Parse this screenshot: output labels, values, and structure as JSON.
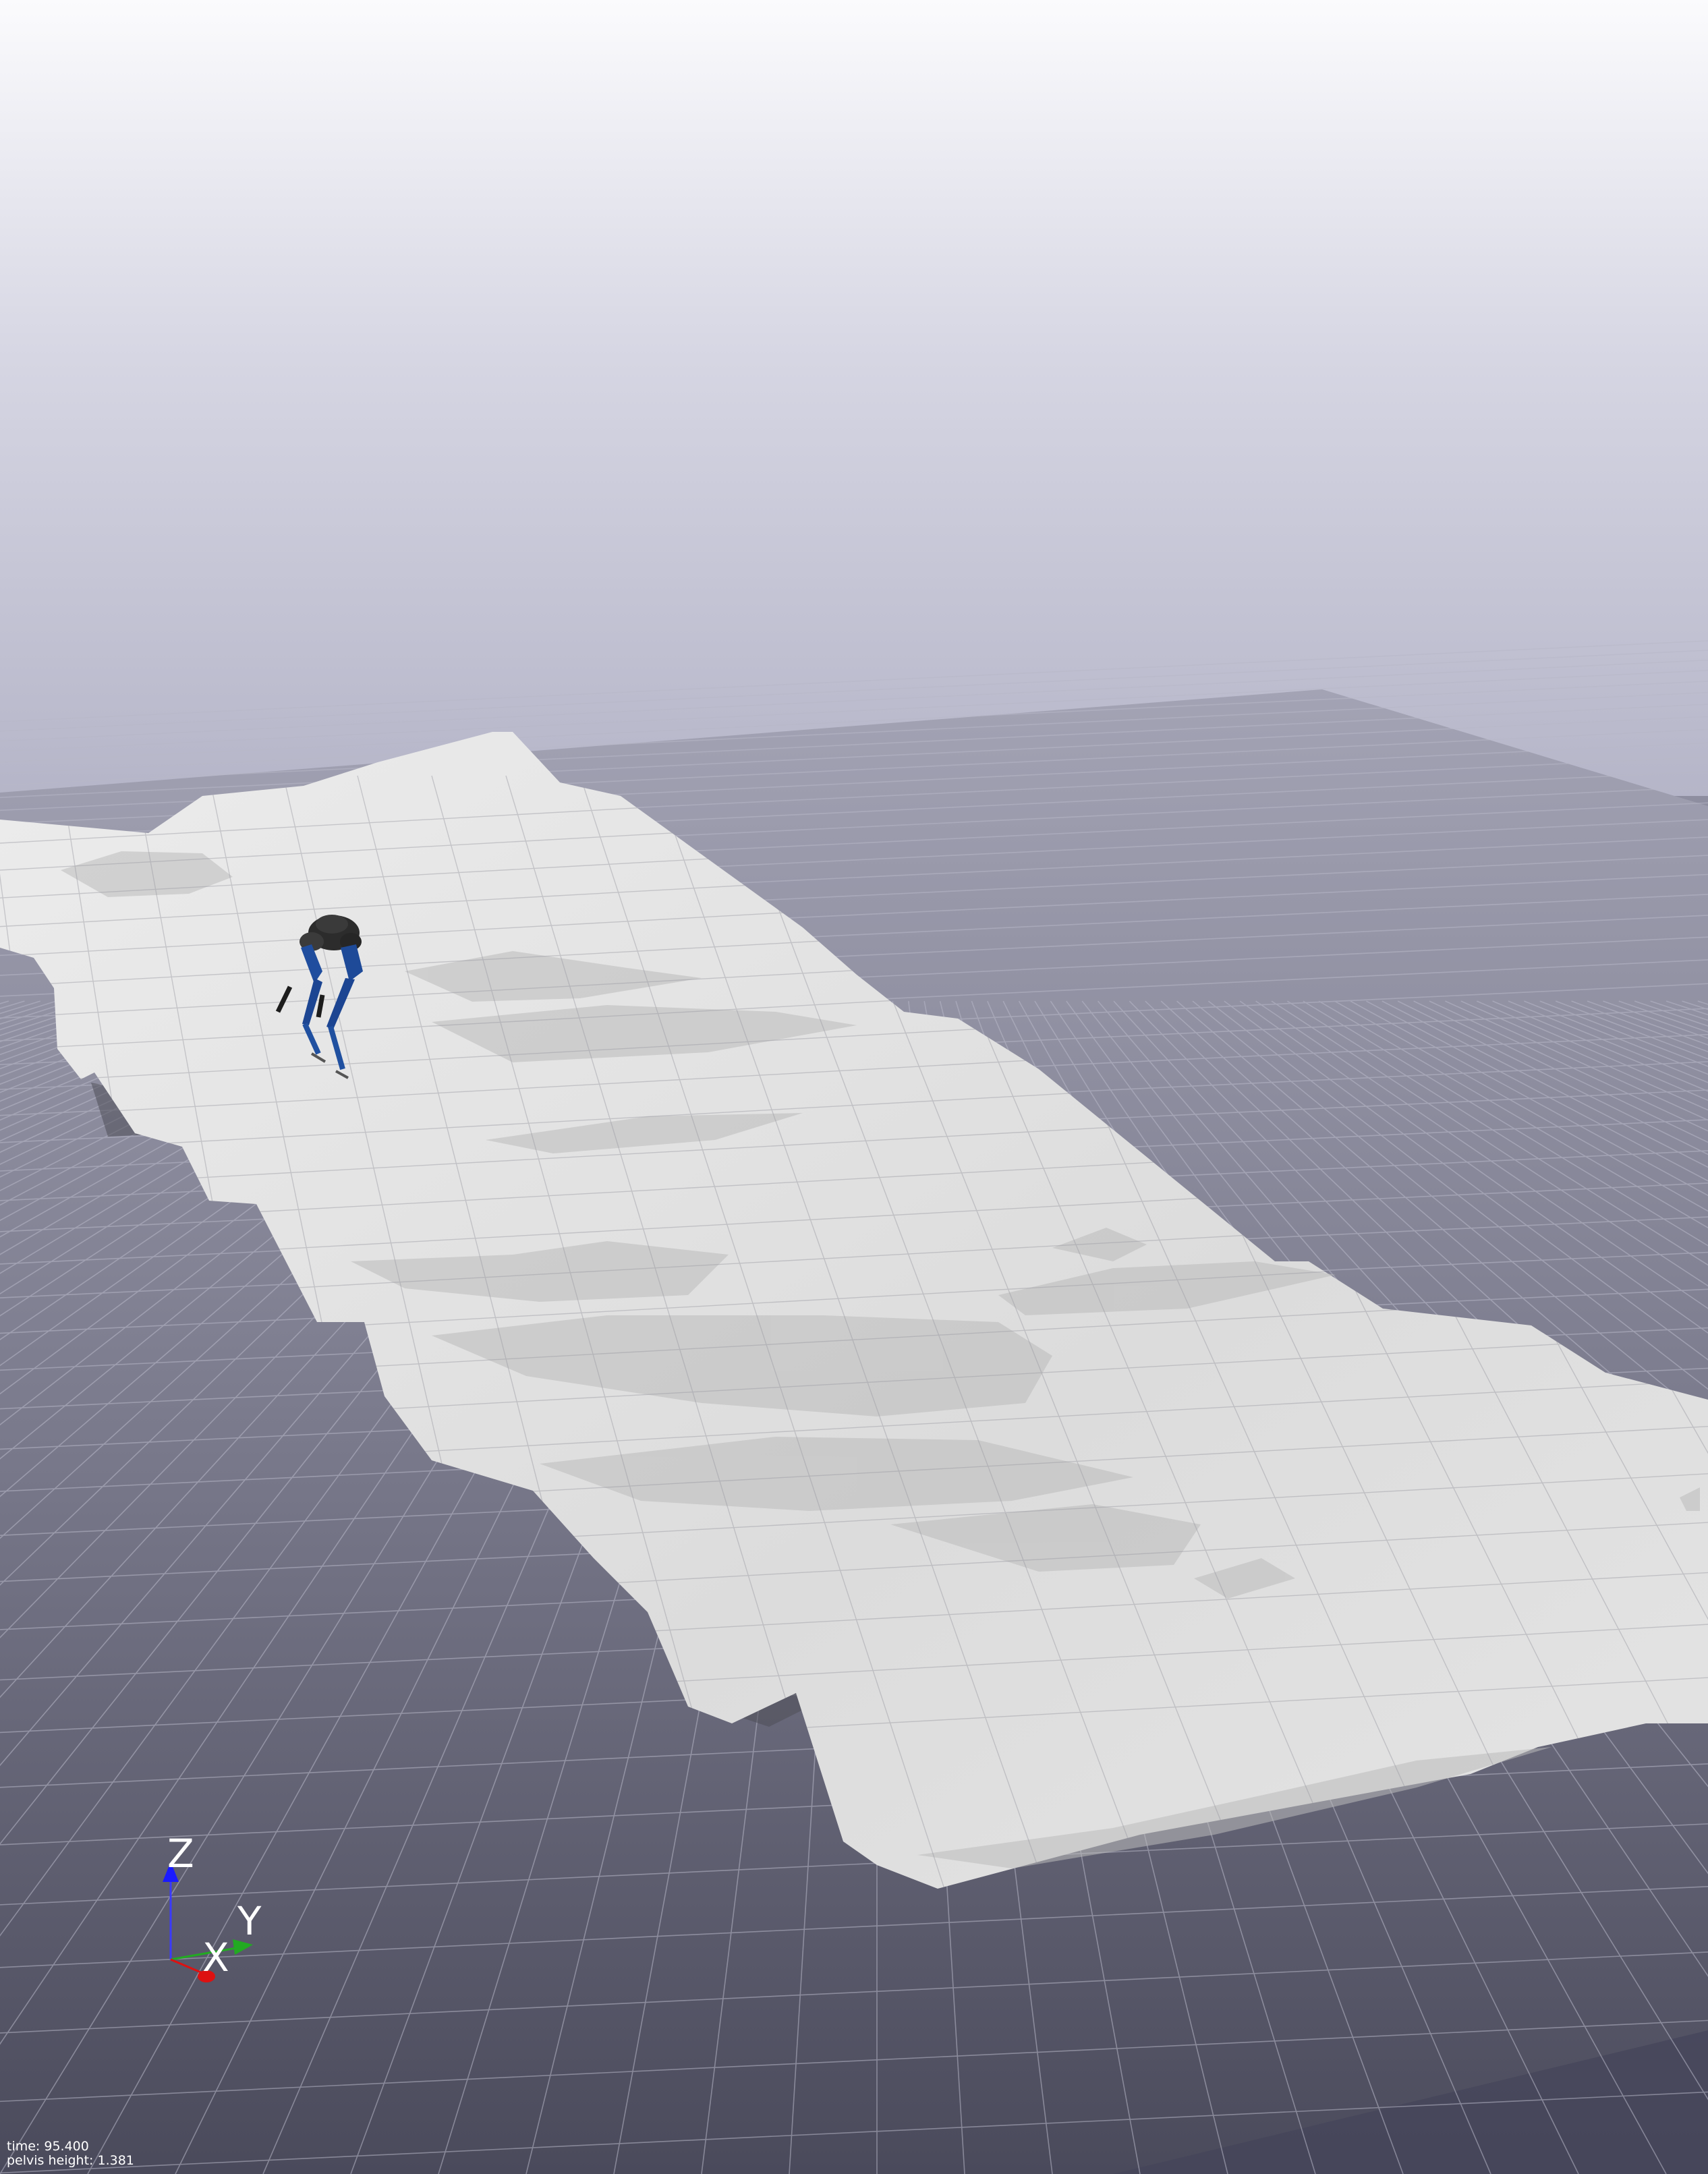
{
  "hud": {
    "time_label": "time: 95.400",
    "pelvis_label": "pelvis height: 1.381"
  },
  "axes_gizmo": {
    "z_label": "Z",
    "y_label": "Y",
    "x_label": "X",
    "z_color": "#1a1aff",
    "y_color": "#22aa22",
    "x_color": "#dd1111"
  },
  "colors": {
    "sky_top": "#fbfbfd",
    "sky_horizon": "#b9b9cb",
    "floor_far": "#9a9aaa",
    "floor_near": "#4d4d5e",
    "terrain": "#e2e2e2",
    "terrain_shade": "#bdbdbd",
    "robot_blue": "#1e4b9a",
    "robot_dark": "#2a2a2a"
  }
}
